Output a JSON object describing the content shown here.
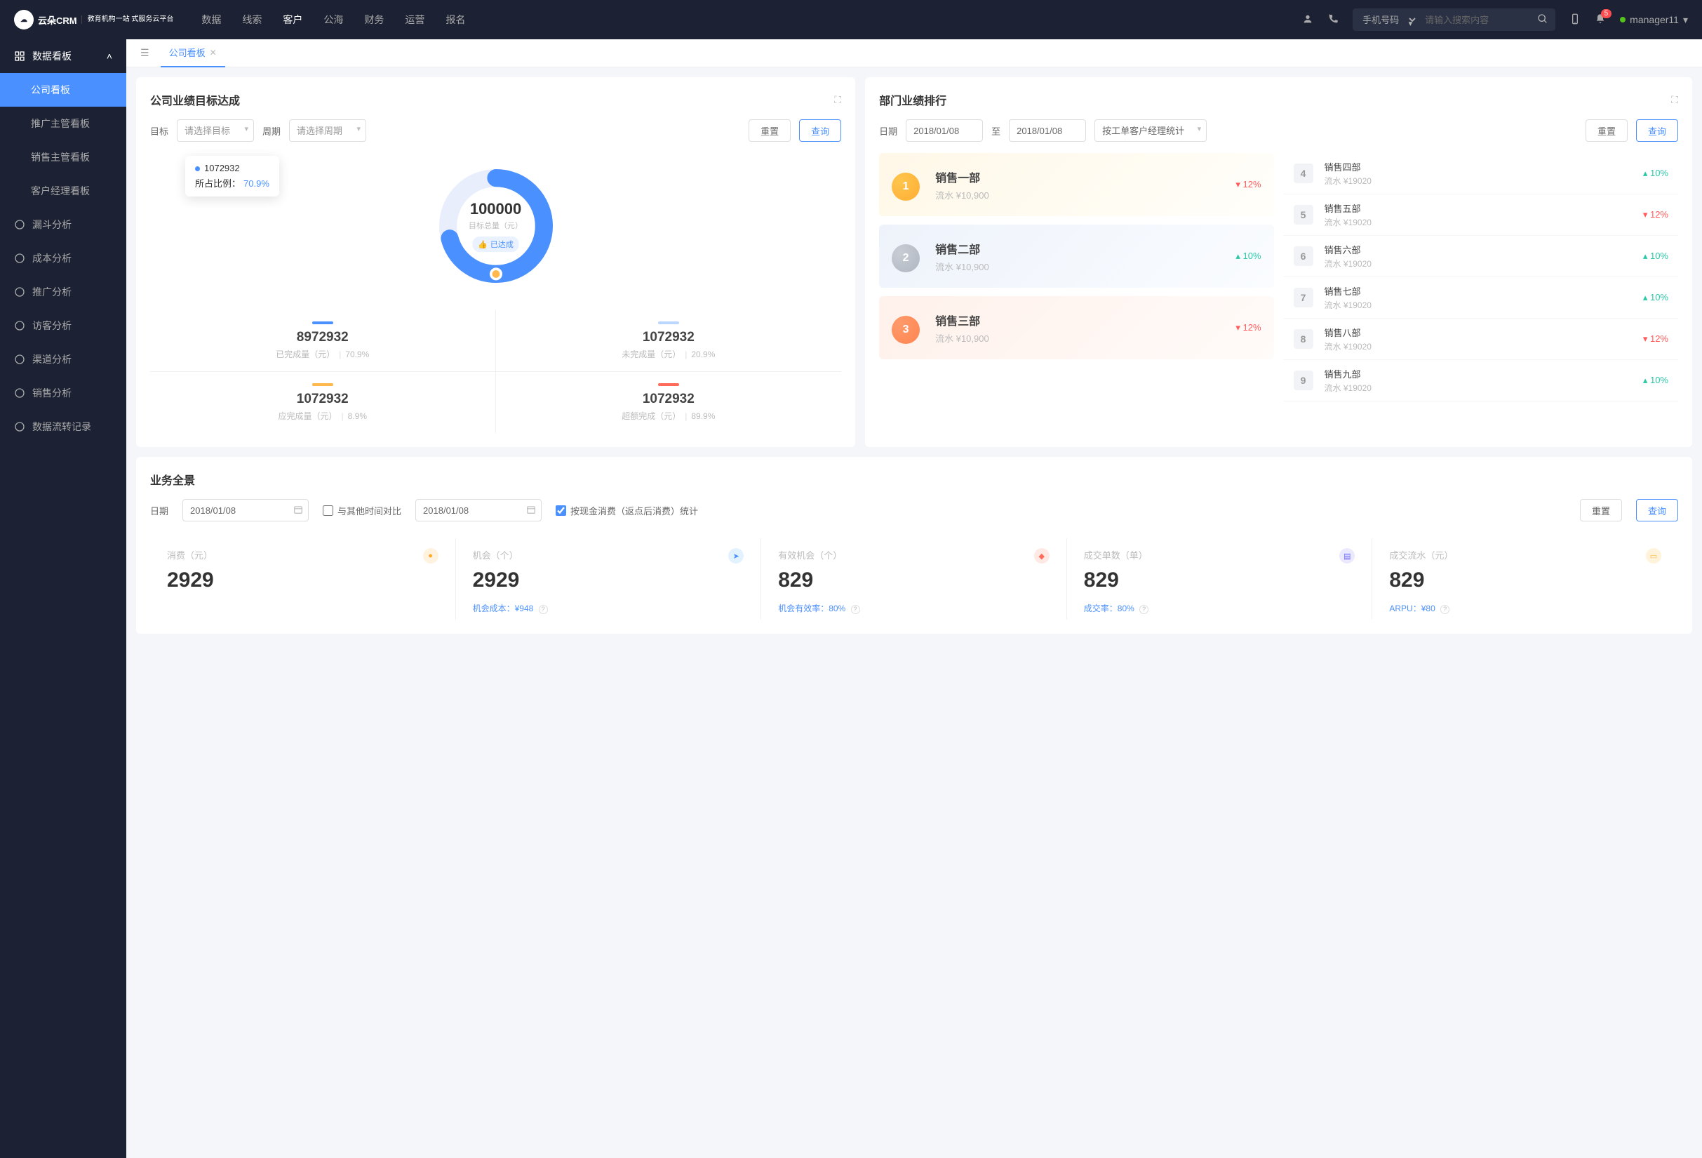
{
  "header": {
    "logo_main": "云朵CRM",
    "logo_sub": "教育机构一站\n式服务云平台",
    "nav": [
      "数据",
      "线索",
      "客户",
      "公海",
      "财务",
      "运营",
      "报名"
    ],
    "search_type": "手机号码",
    "search_placeholder": "请输入搜索内容",
    "badge": "5",
    "user": "manager11"
  },
  "sidebar": {
    "group": "数据看板",
    "subs": [
      "公司看板",
      "推广主管看板",
      "销售主管看板",
      "客户经理看板"
    ],
    "items": [
      "漏斗分析",
      "成本分析",
      "推广分析",
      "访客分析",
      "渠道分析",
      "销售分析",
      "数据流转记录"
    ]
  },
  "tab": {
    "label": "公司看板"
  },
  "target_panel": {
    "title": "公司业绩目标达成",
    "lbl_target": "目标",
    "ph_target": "请选择目标",
    "lbl_period": "周期",
    "ph_period": "请选择周期",
    "btn_reset": "重置",
    "btn_query": "查询",
    "donut_value": "100000",
    "donut_label": "目标总量（元）",
    "donut_tag": "已达成",
    "tooltip_value": "1072932",
    "tooltip_label": "所占比例：",
    "tooltip_pct": "70.9%",
    "metrics": [
      {
        "color": "#4a90ff",
        "val": "8972932",
        "label": "已完成量（元）",
        "pct": "70.9%"
      },
      {
        "color": "#bcd7ff",
        "val": "1072932",
        "label": "未完成量（元）",
        "pct": "20.9%"
      },
      {
        "color": "#ffb84d",
        "val": "1072932",
        "label": "应完成量（元）",
        "pct": "8.9%"
      },
      {
        "color": "#ff6b5b",
        "val": "1072932",
        "label": "超额完成（元）",
        "pct": "89.9%"
      }
    ]
  },
  "rank_panel": {
    "title": "部门业绩排行",
    "lbl_date": "日期",
    "date1": "2018/01/08",
    "date_to": "至",
    "date2": "2018/01/08",
    "group_by": "按工单客户经理统计",
    "btn_reset": "重置",
    "btn_query": "查询",
    "top3": [
      {
        "rank": "1",
        "name": "销售一部",
        "amt": "流水 ¥10,900",
        "pct": "12%",
        "dir": "down",
        "medal_outer": "#ffc54d",
        "medal_inner": "#ffad33"
      },
      {
        "rank": "2",
        "name": "销售二部",
        "amt": "流水 ¥10,900",
        "pct": "10%",
        "dir": "up",
        "medal_outer": "#c8cdd5",
        "medal_inner": "#b0b6c0"
      },
      {
        "rank": "3",
        "name": "销售三部",
        "amt": "流水 ¥10,900",
        "pct": "12%",
        "dir": "down",
        "medal_outer": "#ff9a6b",
        "medal_inner": "#ff8550"
      }
    ],
    "rest": [
      {
        "rank": "4",
        "name": "销售四部",
        "amt": "流水 ¥19020",
        "pct": "10%",
        "dir": "up"
      },
      {
        "rank": "5",
        "name": "销售五部",
        "amt": "流水 ¥19020",
        "pct": "12%",
        "dir": "down"
      },
      {
        "rank": "6",
        "name": "销售六部",
        "amt": "流水 ¥19020",
        "pct": "10%",
        "dir": "up"
      },
      {
        "rank": "7",
        "name": "销售七部",
        "amt": "流水 ¥19020",
        "pct": "10%",
        "dir": "up"
      },
      {
        "rank": "8",
        "name": "销售八部",
        "amt": "流水 ¥19020",
        "pct": "12%",
        "dir": "down"
      },
      {
        "rank": "9",
        "name": "销售九部",
        "amt": "流水 ¥19020",
        "pct": "10%",
        "dir": "up"
      }
    ]
  },
  "overview_panel": {
    "title": "业务全景",
    "lbl_date": "日期",
    "date1": "2018/01/08",
    "compare_label": "与其他时间对比",
    "date2": "2018/01/08",
    "check_label": "按现金消费（返点后消费）统计",
    "btn_reset": "重置",
    "btn_query": "查询",
    "kpis": [
      {
        "label": "消费（元）",
        "val": "2929",
        "sub": "",
        "icon_bg": "#fff3e0",
        "icon_fg": "#ffa726",
        "glyph": "bag"
      },
      {
        "label": "机会（个）",
        "val": "2929",
        "sub": "机会成本：¥948",
        "icon_bg": "#e3f2ff",
        "icon_fg": "#4a90ff",
        "glyph": "send"
      },
      {
        "label": "有效机会（个）",
        "val": "829",
        "sub": "机会有效率：80%",
        "icon_bg": "#ffe9e5",
        "icon_fg": "#ff6b5b",
        "glyph": "shield"
      },
      {
        "label": "成交单数（单）",
        "val": "829",
        "sub": "成交率：80%",
        "icon_bg": "#eae9ff",
        "icon_fg": "#6b66ff",
        "glyph": "doc"
      },
      {
        "label": "成交流水（元）",
        "val": "829",
        "sub": "ARPU：¥80",
        "icon_bg": "#fff3dc",
        "icon_fg": "#ffb84d",
        "glyph": "card"
      }
    ]
  },
  "chart_data": {
    "type": "pie",
    "title": "公司业绩目标达成",
    "total": 100000,
    "total_label": "目标总量（元）",
    "series": [
      {
        "name": "已完成量（元）",
        "value": 8972932,
        "pct": 70.9,
        "color": "#4a90ff"
      },
      {
        "name": "未完成量（元）",
        "value": 1072932,
        "pct": 20.9,
        "color": "#bcd7ff"
      },
      {
        "name": "应完成量（元）",
        "value": 1072932,
        "pct": 8.9,
        "color": "#ffb84d"
      },
      {
        "name": "超额完成（元）",
        "value": 1072932,
        "pct": 89.9,
        "color": "#ff6b5b"
      }
    ]
  }
}
